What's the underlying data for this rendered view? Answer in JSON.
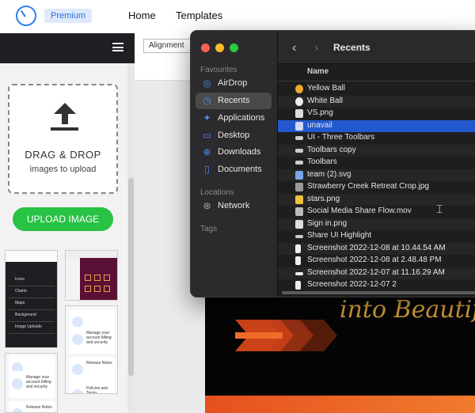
{
  "web_nav": {
    "premium_badge": "Premium",
    "links": [
      "Home",
      "Templates"
    ]
  },
  "editor": {
    "dropzone_title": "DRAG & DROP",
    "dropzone_sub": "images to upload",
    "upload_button": "UPLOAD IMAGE",
    "alignment_button": "Alignment",
    "design_text": "into Beautif",
    "thumb_menu": [
      "Icons",
      "Charts",
      "Maps",
      "Background",
      "Image Uploads"
    ],
    "thumb_cards": [
      "Manage your account billing and security",
      "Release Notes",
      "Policies and Terms"
    ]
  },
  "finder": {
    "title": "Recents",
    "column_name": "Name",
    "sidebar": {
      "favourites_heading": "Favourites",
      "favourites": [
        {
          "label": "AirDrop",
          "icon": "airdrop-icon"
        },
        {
          "label": "Recents",
          "icon": "clock-icon"
        },
        {
          "label": "Applications",
          "icon": "applications-icon"
        },
        {
          "label": "Desktop",
          "icon": "desktop-icon"
        },
        {
          "label": "Downloads",
          "icon": "downloads-icon"
        },
        {
          "label": "Documents",
          "icon": "documents-icon"
        }
      ],
      "locations_heading": "Locations",
      "locations": [
        {
          "label": "Network",
          "icon": "network-icon"
        }
      ],
      "tags_heading": "Tags"
    },
    "files": [
      "Yellow Ball",
      "White Ball",
      "VS.png",
      "unavail",
      "UI - Three Toolbars",
      "Toolbars copy",
      "Toolbars",
      "team (2).svg",
      "Strawberry Creek Retreat Crop.jpg",
      "stars.png",
      "Social Media Share Flow.mov",
      "Sign in.png",
      "Share UI Highlight",
      "Screenshot 2022-12-08 at 10.44.54 AM",
      "Screenshot 2022-12-08 at 2.48.48 PM",
      "Screenshot 2022-12-07 at 11.16.29 AM",
      "Screenshot 2022-12-07 2"
    ],
    "selected_file": "unavail",
    "colors": {
      "selection": "#2458cf",
      "sidebar_accent": "#4a90f5"
    }
  }
}
